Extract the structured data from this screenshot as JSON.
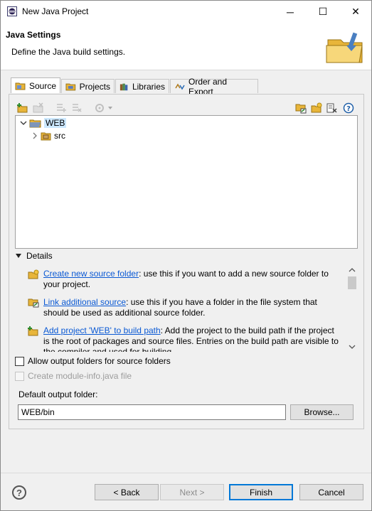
{
  "window": {
    "title": "New Java Project",
    "minimize": "─",
    "maximize": "☐",
    "close": "✕"
  },
  "header": {
    "title": "Java Settings",
    "subtitle": "Define the Java build settings."
  },
  "tabs": [
    {
      "label": "Source",
      "icon": "source-folder-icon"
    },
    {
      "label": "Projects",
      "icon": "projects-icon"
    },
    {
      "label": "Libraries",
      "icon": "libraries-icon"
    },
    {
      "label": "Order and Export",
      "icon": "order-export-icon"
    }
  ],
  "tree": {
    "project": "WEB",
    "child": "src"
  },
  "details": {
    "header": "Details",
    "items": [
      {
        "link": "Create new source folder",
        "text": ": use this if you want to add a new source folder to your project."
      },
      {
        "link": "Link additional source",
        "text": ": use this if you have a folder in the file system that should be used as additional source folder."
      },
      {
        "link": "Add project 'WEB' to build path",
        "text": ": Add the project to the build path if the project is the root of packages and source files. Entries on the build path are visible to the compiler and used for building."
      }
    ]
  },
  "options": {
    "allow_output": "Allow output folders for source folders",
    "module_info": "Create module-info.java file"
  },
  "output": {
    "label": "Default output folder:",
    "value": "WEB/bin",
    "browse": "Browse..."
  },
  "buttons": {
    "help": "?",
    "back": "< Back",
    "next": "Next >",
    "finish": "Finish",
    "cancel": "Cancel"
  },
  "colors": {
    "link": "#0a59d4",
    "primary_border": "#0078d7",
    "selection": "#cce8ff"
  }
}
